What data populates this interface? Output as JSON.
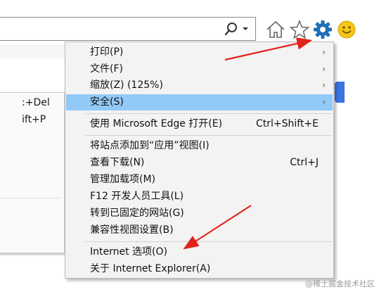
{
  "menu": {
    "items": [
      {
        "label": "打印(P)",
        "shortcut": "",
        "submenu": true
      },
      {
        "label": "文件(F)",
        "shortcut": "",
        "submenu": true
      },
      {
        "label": "缩放(Z) (125%)",
        "shortcut": "",
        "submenu": true
      },
      {
        "label": "安全(S)",
        "shortcut": "",
        "submenu": true,
        "highlighted": true
      },
      {
        "label": "使用 Microsoft Edge 打开(E)",
        "shortcut": "Ctrl+Shift+E"
      },
      {
        "label": "将站点添加到“应用”视图(I)",
        "shortcut": ""
      },
      {
        "label": "查看下载(N)",
        "shortcut": "Ctrl+J"
      },
      {
        "label": "管理加载项(M)",
        "shortcut": ""
      },
      {
        "label": "F12 开发人员工具(L)",
        "shortcut": ""
      },
      {
        "label": "转到已固定的网站(G)",
        "shortcut": ""
      },
      {
        "label": "兼容性视图设置(B)",
        "shortcut": ""
      },
      {
        "label": "Internet 选项(O)",
        "shortcut": ""
      },
      {
        "label": "关于 Internet Explorer(A)",
        "shortcut": ""
      }
    ],
    "arrow_glyph": "›"
  },
  "submenu": {
    "items": [
      ":+Del",
      "ift+P"
    ]
  },
  "toolbar": {
    "icons": [
      "search-icon",
      "dropdown-caret-icon",
      "home-icon",
      "favorites-star-icon",
      "settings-gear-icon",
      "feedback-smiley-icon"
    ]
  },
  "watermark": "@稀土掘金技术社区",
  "colors": {
    "highlight": "#91c9f7",
    "annotation_arrow": "#e0241b",
    "gear": "#1e6fb8",
    "smiley": "#f5c518"
  }
}
